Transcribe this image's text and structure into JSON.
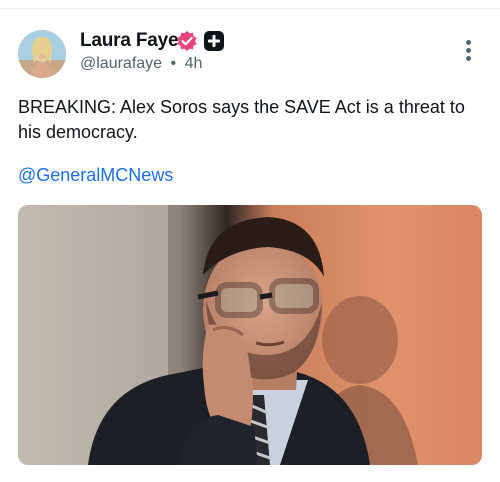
{
  "post": {
    "author_name": "Laura Faye",
    "handle": "@laurafaye",
    "separator": "•",
    "time": "4h",
    "text": "BREAKING: Alex Soros says the SAVE Act is a threat to his democracy.",
    "mention": "@GeneralMCNews"
  },
  "icons": {
    "verified": "verified-badge-icon",
    "plus": "plus-badge-icon",
    "menu": "more-vertical-icon"
  },
  "colors": {
    "verified_badge": "#e8457a",
    "link": "#1d6ee8",
    "secondary_text": "#536471"
  }
}
